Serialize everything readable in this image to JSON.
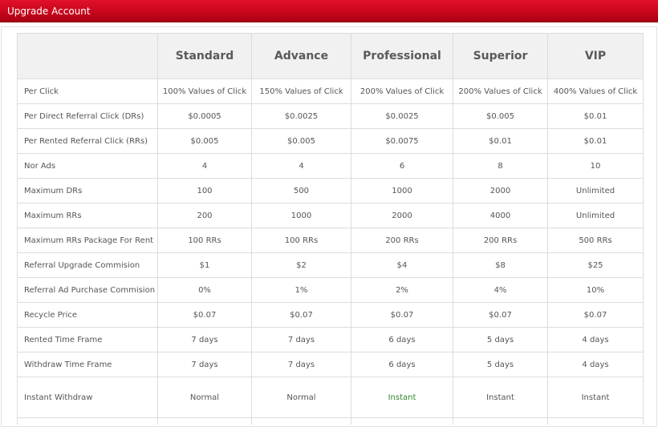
{
  "panel": {
    "title": "Upgrade Account"
  },
  "plans": [
    "Standard",
    "Advance",
    "Professional",
    "Superior",
    "VIP"
  ],
  "rows": [
    {
      "feature": "Per Click",
      "values": [
        "100% Values of Click",
        "150% Values of Click",
        "200% Values of Click",
        "200% Values of Click",
        "400% Values of Click"
      ]
    },
    {
      "feature": "Per Direct Referral Click (DRs)",
      "values": [
        "$0.0005",
        "$0.0025",
        "$0.0025",
        "$0.005",
        "$0.01"
      ]
    },
    {
      "feature": "Per Rented Referral Click (RRs)",
      "values": [
        "$0.005",
        "$0.005",
        "$0.0075",
        "$0.01",
        "$0.01"
      ]
    },
    {
      "feature": "Nor Ads",
      "values": [
        "4",
        "4",
        "6",
        "8",
        "10"
      ]
    },
    {
      "feature": "Maximum DRs",
      "values": [
        "100",
        "500",
        "1000",
        "2000",
        "Unlimited"
      ]
    },
    {
      "feature": "Maximum RRs",
      "values": [
        "200",
        "1000",
        "2000",
        "4000",
        "Unlimited"
      ]
    },
    {
      "feature": "Maximum RRs Package For Rent",
      "values": [
        "100 RRs",
        "100 RRs",
        "200 RRs",
        "200 RRs",
        "500 RRs"
      ]
    },
    {
      "feature": "Referral Upgrade Commision",
      "values": [
        "$1",
        "$2",
        "$4",
        "$8",
        "$25"
      ]
    },
    {
      "feature": "Referral Ad Purchase Commision",
      "values": [
        "0%",
        "1%",
        "2%",
        "4%",
        "10%"
      ]
    },
    {
      "feature": "Recycle Price",
      "values": [
        "$0.07",
        "$0.07",
        "$0.07",
        "$0.07",
        "$0.07"
      ]
    },
    {
      "feature": "Rented Time Frame",
      "values": [
        "7 days",
        "7 days",
        "6 days",
        "5 days",
        "4 days"
      ]
    },
    {
      "feature": "Withdraw Time Frame",
      "values": [
        "7 days",
        "7 days",
        "6 days",
        "5 days",
        "4 days"
      ]
    },
    {
      "feature": "Instant Withdraw",
      "values": [
        "Normal",
        "Normal",
        "Instant",
        "Instant",
        "Instant"
      ]
    }
  ],
  "colors": {
    "header_bar": "#c8061c",
    "instant_highlight": "#2e8b2e",
    "table_border": "#dcdcdc",
    "header_cell_bg": "#f1f1f1"
  }
}
